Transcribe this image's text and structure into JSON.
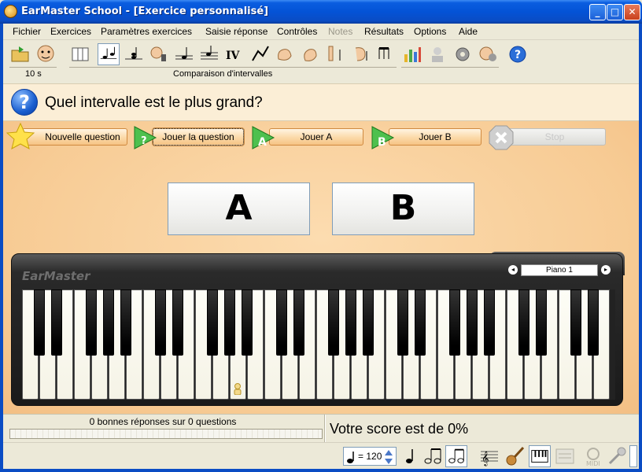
{
  "window": {
    "title": "EarMaster School - [Exercice personnalisé]",
    "minimize_glyph": "_",
    "maximize_glyph": "□",
    "close_glyph": "✕"
  },
  "menu": {
    "items": [
      {
        "label": "Fichier",
        "enabled": true
      },
      {
        "label": "Exercices",
        "enabled": true
      },
      {
        "label": "Paramètres exercices",
        "enabled": true
      },
      {
        "label": "Saisie réponse",
        "enabled": true
      },
      {
        "label": "Contrôles",
        "enabled": true
      },
      {
        "label": "Notes",
        "enabled": false
      },
      {
        "label": "Résultats",
        "enabled": true
      },
      {
        "label": "Options",
        "enabled": true
      },
      {
        "label": "Aide",
        "enabled": true
      }
    ]
  },
  "toolbar": {
    "timer_label": "10 s",
    "exercise_label": "Comparaison d'intervalles"
  },
  "question": {
    "text": "Quel intervalle est le plus grand?"
  },
  "actions": {
    "new_question": "Nouvelle question",
    "play_question": "Jouer la question",
    "play_a": "Jouer A",
    "play_b": "Jouer B",
    "stop": "Stop"
  },
  "answers": {
    "a": "A",
    "b": "B"
  },
  "keyboard": {
    "brand": "EarMaster",
    "instrument": "Piano 1",
    "prev_glyph": "◂",
    "next_glyph": "▸"
  },
  "status": {
    "correct_count": "0 bonnes réponses sur 0 questions",
    "score": "Votre score est de 0%",
    "progress_fraction": 0
  },
  "bottombar": {
    "tempo_value": "= 120"
  },
  "colors": {
    "title_blue": "#0453d6",
    "panel_orange": "#f7cb94",
    "question_bg": "#fbeed6",
    "help_blue": "#1a5fd0"
  }
}
